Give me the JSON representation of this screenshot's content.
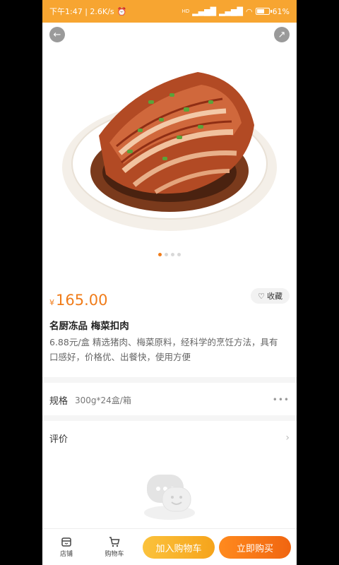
{
  "status": {
    "time_speed": "下午1:47 | 2.6K/s",
    "battery": "61%",
    "signal": "HD"
  },
  "product": {
    "currency": "¥",
    "price": "165.00",
    "favorite_label": "收藏",
    "title": "名厨冻品  梅菜扣肉",
    "description": "6.88元/盒  精选猪肉、梅菜原料，经科学的烹饪方法，具有口感好，价格优、出餐快，使用方便",
    "carousel": {
      "count": 4,
      "active": 0
    }
  },
  "spec": {
    "label": "规格",
    "value": "300g*24盒/箱",
    "more": "•••"
  },
  "review": {
    "label": "评价",
    "chevron": "›"
  },
  "bottom": {
    "store_label": "店铺",
    "cart_label": "购物车",
    "add_to_cart": "加入购物车",
    "buy_now": "立即购买"
  },
  "colors": {
    "status_bar": "#f7a531",
    "price": "#f07c1a",
    "cart_button": "#f6a41b",
    "buy_button": "#f06510"
  }
}
